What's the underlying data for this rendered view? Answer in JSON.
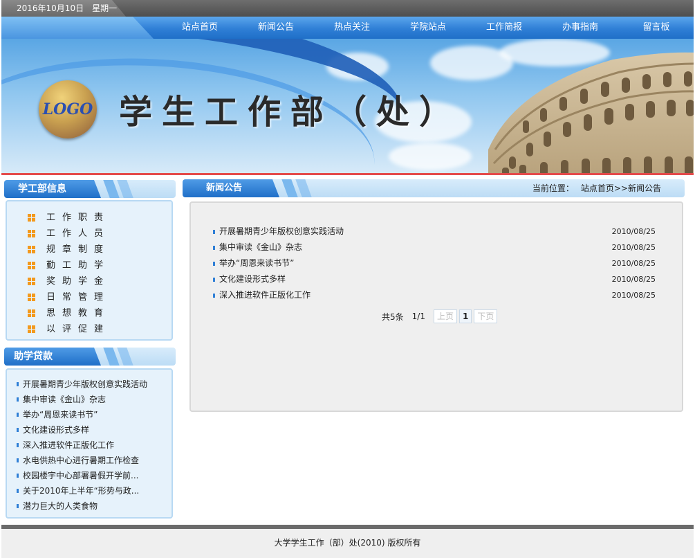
{
  "topbar": {
    "date": "2016年10月10日",
    "weekday": "星期一"
  },
  "nav": [
    "站点首页",
    "新闻公告",
    "热点关注",
    "学院站点",
    "工作简报",
    "办事指南",
    "留言板"
  ],
  "banner": {
    "logo_text": "LOGO",
    "title": "学生工作部（处）"
  },
  "sidebar_info": {
    "title": "学工部信息",
    "items": [
      "工作职责",
      "工作人员",
      "规章制度",
      "勤工助学",
      "奖助学金",
      "日常管理",
      "思想教育",
      "以评促建"
    ]
  },
  "sidebar_loan": {
    "title": "助学贷款",
    "items": [
      "开展暑期青少年版权创意实践活动",
      "集中审读《金山》杂志",
      "举办“周恩来读书节”",
      "文化建设形式多样",
      "深入推进软件正版化工作",
      "水电供热中心进行暑期工作检查",
      "校园楼宇中心部署暑假开学前...",
      "关于2010年上半年“形势与政...",
      "潜力巨大的人类食物"
    ]
  },
  "main": {
    "title": "新闻公告",
    "crumb_label": "当前位置：",
    "crumb_path": "站点首页>>新闻公告",
    "articles": [
      {
        "title": "开展暑期青少年版权创意实践活动",
        "date": "2010/08/25"
      },
      {
        "title": "集中审读《金山》杂志",
        "date": "2010/08/25"
      },
      {
        "title": "举办“周恩来读书节”",
        "date": "2010/08/25"
      },
      {
        "title": "文化建设形式多样",
        "date": "2010/08/25"
      },
      {
        "title": "深入推进软件正版化工作",
        "date": "2010/08/25"
      }
    ],
    "pager": {
      "total": "共5条",
      "pages": "1/1",
      "prev": "上页",
      "current": "1",
      "next": "下页"
    }
  },
  "footer": {
    "text": "大学学生工作（部）处(2010) 版权所有"
  },
  "colors": {
    "nav_blue": "#2f7fd6",
    "accent_orange": "#f39a1e",
    "red_line": "#e44a4a"
  }
}
